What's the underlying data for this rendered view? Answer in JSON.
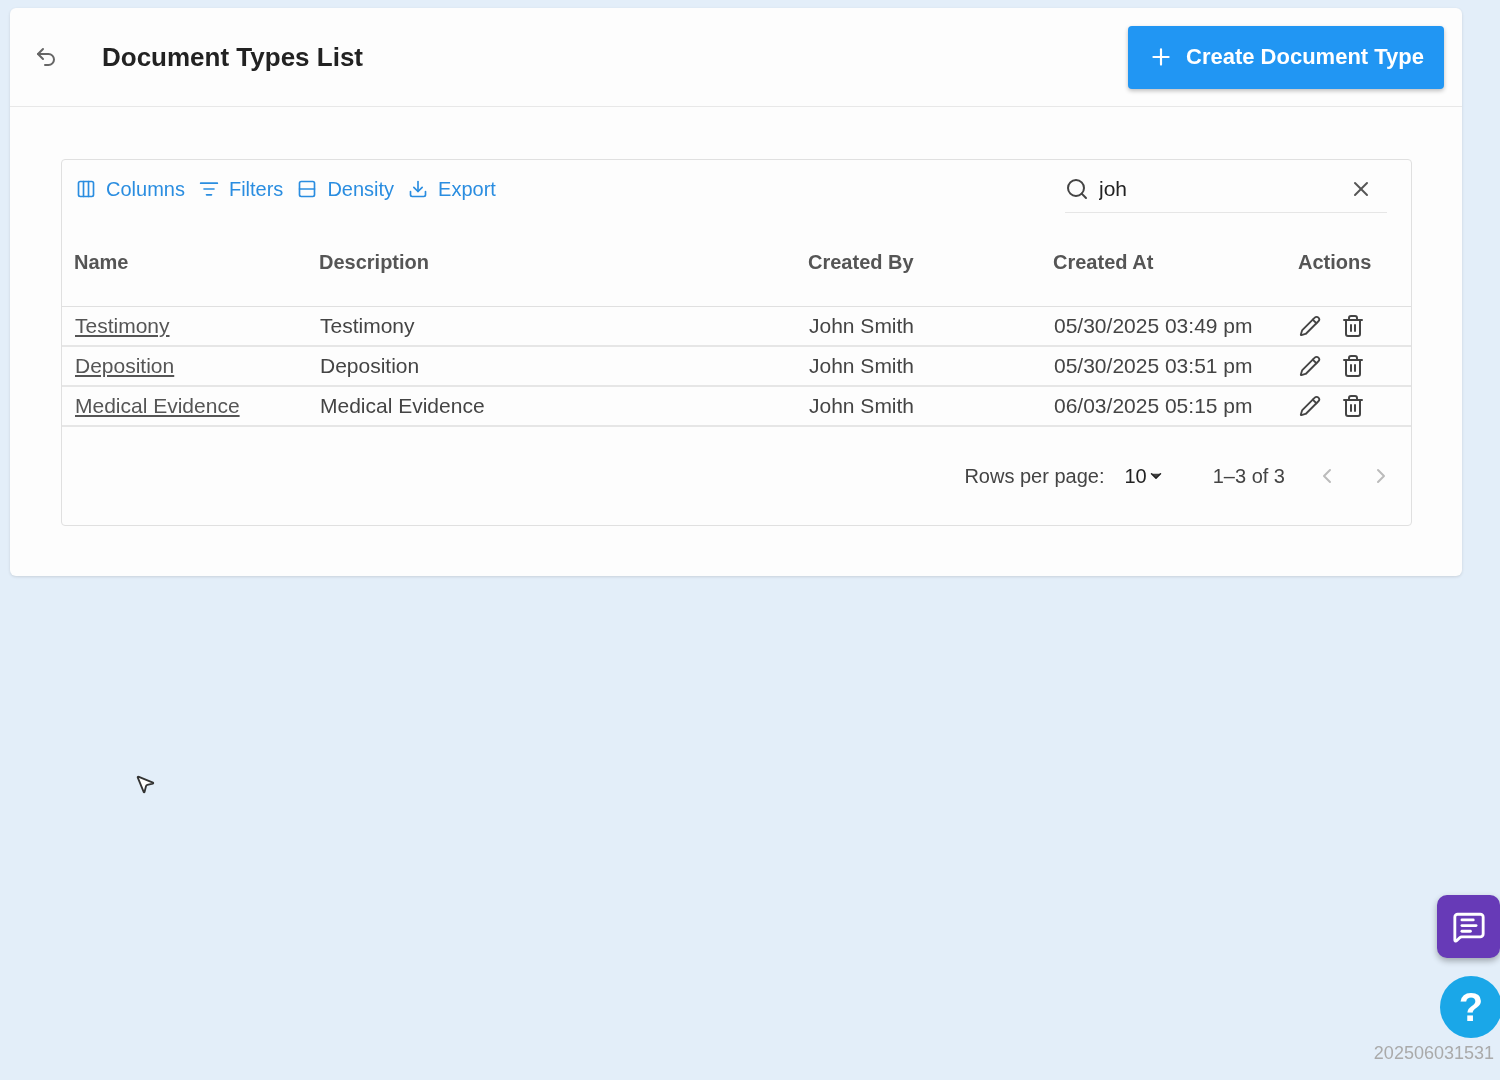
{
  "header": {
    "title": "Document Types List",
    "create_button": "Create Document Type"
  },
  "toolbar": {
    "buttons": [
      {
        "kind": "columns",
        "label": "Columns"
      },
      {
        "kind": "filters",
        "label": "Filters"
      },
      {
        "kind": "density",
        "label": "Density"
      },
      {
        "kind": "export",
        "label": "Export"
      }
    ],
    "search": {
      "value": "joh"
    }
  },
  "table": {
    "columns": [
      "Name",
      "Description",
      "Created By",
      "Created At",
      "Actions"
    ],
    "rows": [
      {
        "name": "Testimony",
        "description": "Testimony",
        "created_by": "John Smith",
        "created_at": "05/30/2025 03:49 pm"
      },
      {
        "name": "Deposition",
        "description": "Deposition",
        "created_by": "John Smith",
        "created_at": "05/30/2025 03:51 pm"
      },
      {
        "name": "Medical Evidence",
        "description": "Medical Evidence",
        "created_by": "John Smith",
        "created_at": "06/03/2025 05:15 pm"
      }
    ]
  },
  "pagination": {
    "rows_per_page_label": "Rows per page:",
    "rows_per_page": "10",
    "range": "1–3 of 3"
  },
  "help_button": "?",
  "version": "202506031531"
}
